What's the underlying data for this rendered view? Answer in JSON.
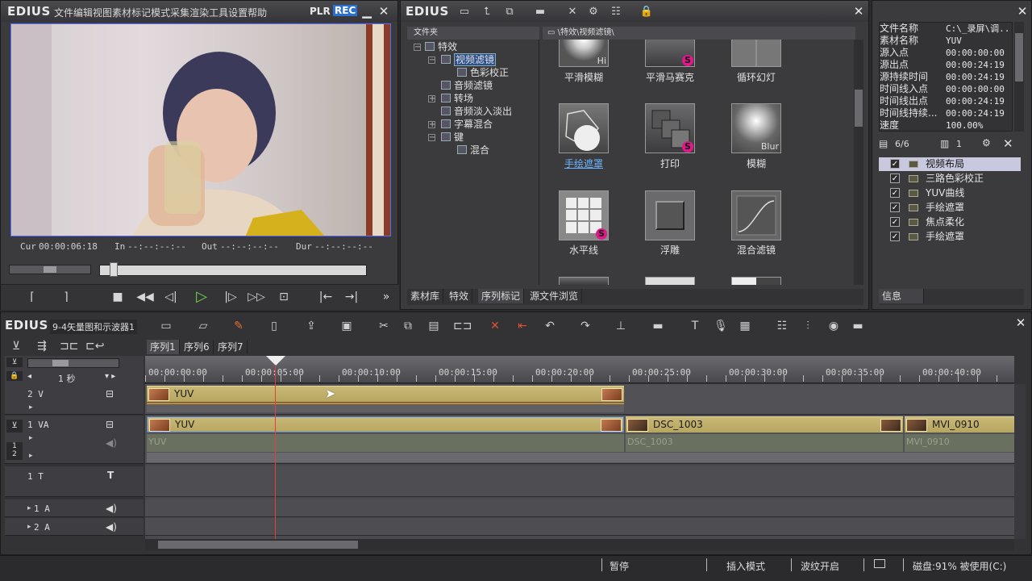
{
  "player": {
    "logo": "EDIUS",
    "menu": [
      "文件",
      "编辑",
      "视图",
      "素材",
      "标记",
      "模式",
      "采集",
      "渲染",
      "工具",
      "设置",
      "帮助"
    ],
    "plr": "PLR",
    "rec": "REC",
    "cur_label": "Cur",
    "cur_value": "00:00:06:18",
    "in_label": "In",
    "in_value": "--:--:--:--",
    "out_label": "Out",
    "out_value": "--:--:--:--",
    "dur_label": "Dur",
    "dur_value": "--:--:--:--"
  },
  "library": {
    "logo": "EDIUS",
    "folder_header": "文件夹",
    "path": "\\特效\\视频滤镜\\",
    "tree": [
      {
        "label": "特效",
        "indent": 0,
        "expand": "−"
      },
      {
        "label": "视频滤镜",
        "indent": 1,
        "expand": "−",
        "selected": true
      },
      {
        "label": "色彩校正",
        "indent": 2,
        "expand": ""
      },
      {
        "label": "音频滤镜",
        "indent": 1,
        "expand": ""
      },
      {
        "label": "转场",
        "indent": 1,
        "expand": "+"
      },
      {
        "label": "音频淡入淡出",
        "indent": 1,
        "expand": ""
      },
      {
        "label": "字幕混合",
        "indent": 1,
        "expand": "+"
      },
      {
        "label": "键",
        "indent": 1,
        "expand": "−"
      },
      {
        "label": "混合",
        "indent": 2,
        "expand": ""
      }
    ],
    "tiles_row0": [
      {
        "label": "平滑模糊",
        "mark": "Hi"
      },
      {
        "label": "平滑马赛克",
        "mark": "S"
      },
      {
        "label": "循环幻灯",
        "mark": ""
      }
    ],
    "tiles_row1": [
      {
        "label": "手绘遮罩",
        "mark": "",
        "selected": true
      },
      {
        "label": "打印",
        "mark": "S"
      },
      {
        "label": "模糊",
        "mark": "Blur"
      }
    ],
    "tiles_row2": [
      {
        "label": "水平线",
        "mark": "S"
      },
      {
        "label": "浮雕",
        "mark": ""
      },
      {
        "label": "混合滤镜",
        "mark": ""
      }
    ],
    "tabs": [
      "素材库",
      "特效",
      "序列标记",
      "源文件浏览"
    ]
  },
  "info": {
    "props": [
      {
        "label": "文件名称",
        "value": "C:\\_录屏\\调..."
      },
      {
        "label": "素材名称",
        "value": "YUV"
      },
      {
        "label": "源入点",
        "value": "00:00:00:00"
      },
      {
        "label": "源出点",
        "value": "00:00:24:19"
      },
      {
        "label": "源持续时间",
        "value": "00:00:24:19"
      },
      {
        "label": "时间线入点",
        "value": "00:00:00:00"
      },
      {
        "label": "时间线出点",
        "value": "00:00:24:19"
      },
      {
        "label": "时间线持续...",
        "value": "00:00:24:19"
      },
      {
        "label": "速度",
        "value": "100.00%"
      }
    ],
    "count": "6/6",
    "layer": "1",
    "effects": [
      {
        "label": "视频布局",
        "selected": true
      },
      {
        "label": "三路色彩校正"
      },
      {
        "label": "YUV曲线"
      },
      {
        "label": "手绘遮罩"
      },
      {
        "label": "焦点柔化"
      },
      {
        "label": "手绘遮罩"
      }
    ],
    "tab": "信息"
  },
  "timeline": {
    "logo": "EDIUS",
    "project": "9-4矢量图和示波器1",
    "seq_tabs": [
      "序列1",
      "序列6",
      "序列7"
    ],
    "zoom": "1 秒",
    "ruler": [
      "00:00:00:00",
      "00:00:05:00",
      "00:00:10:00",
      "00:00:15:00",
      "00:00:20:00",
      "00:00:25:00",
      "00:00:30:00",
      "00:00:35:00",
      "00:00:40:00"
    ],
    "tracks": {
      "v2": "2 V",
      "va1": "1 VA",
      "a12": "1\n2",
      "t1": "1 T",
      "a1": "1 A",
      "a2": "2 A"
    },
    "clips": {
      "v2_clip": "YUV",
      "va_clip1": "YUV",
      "va_clip2": "DSC_1003",
      "va_clip3": "MVI_0910",
      "a_clip1": "YUV",
      "a_clip2": "DSC_1003",
      "a_clip3": "MVI_0910"
    }
  },
  "status": {
    "state": "暂停",
    "mode": "插入模式",
    "ripple": "波纹开启",
    "disk": "磁盘:91% 被使用(C:)"
  }
}
